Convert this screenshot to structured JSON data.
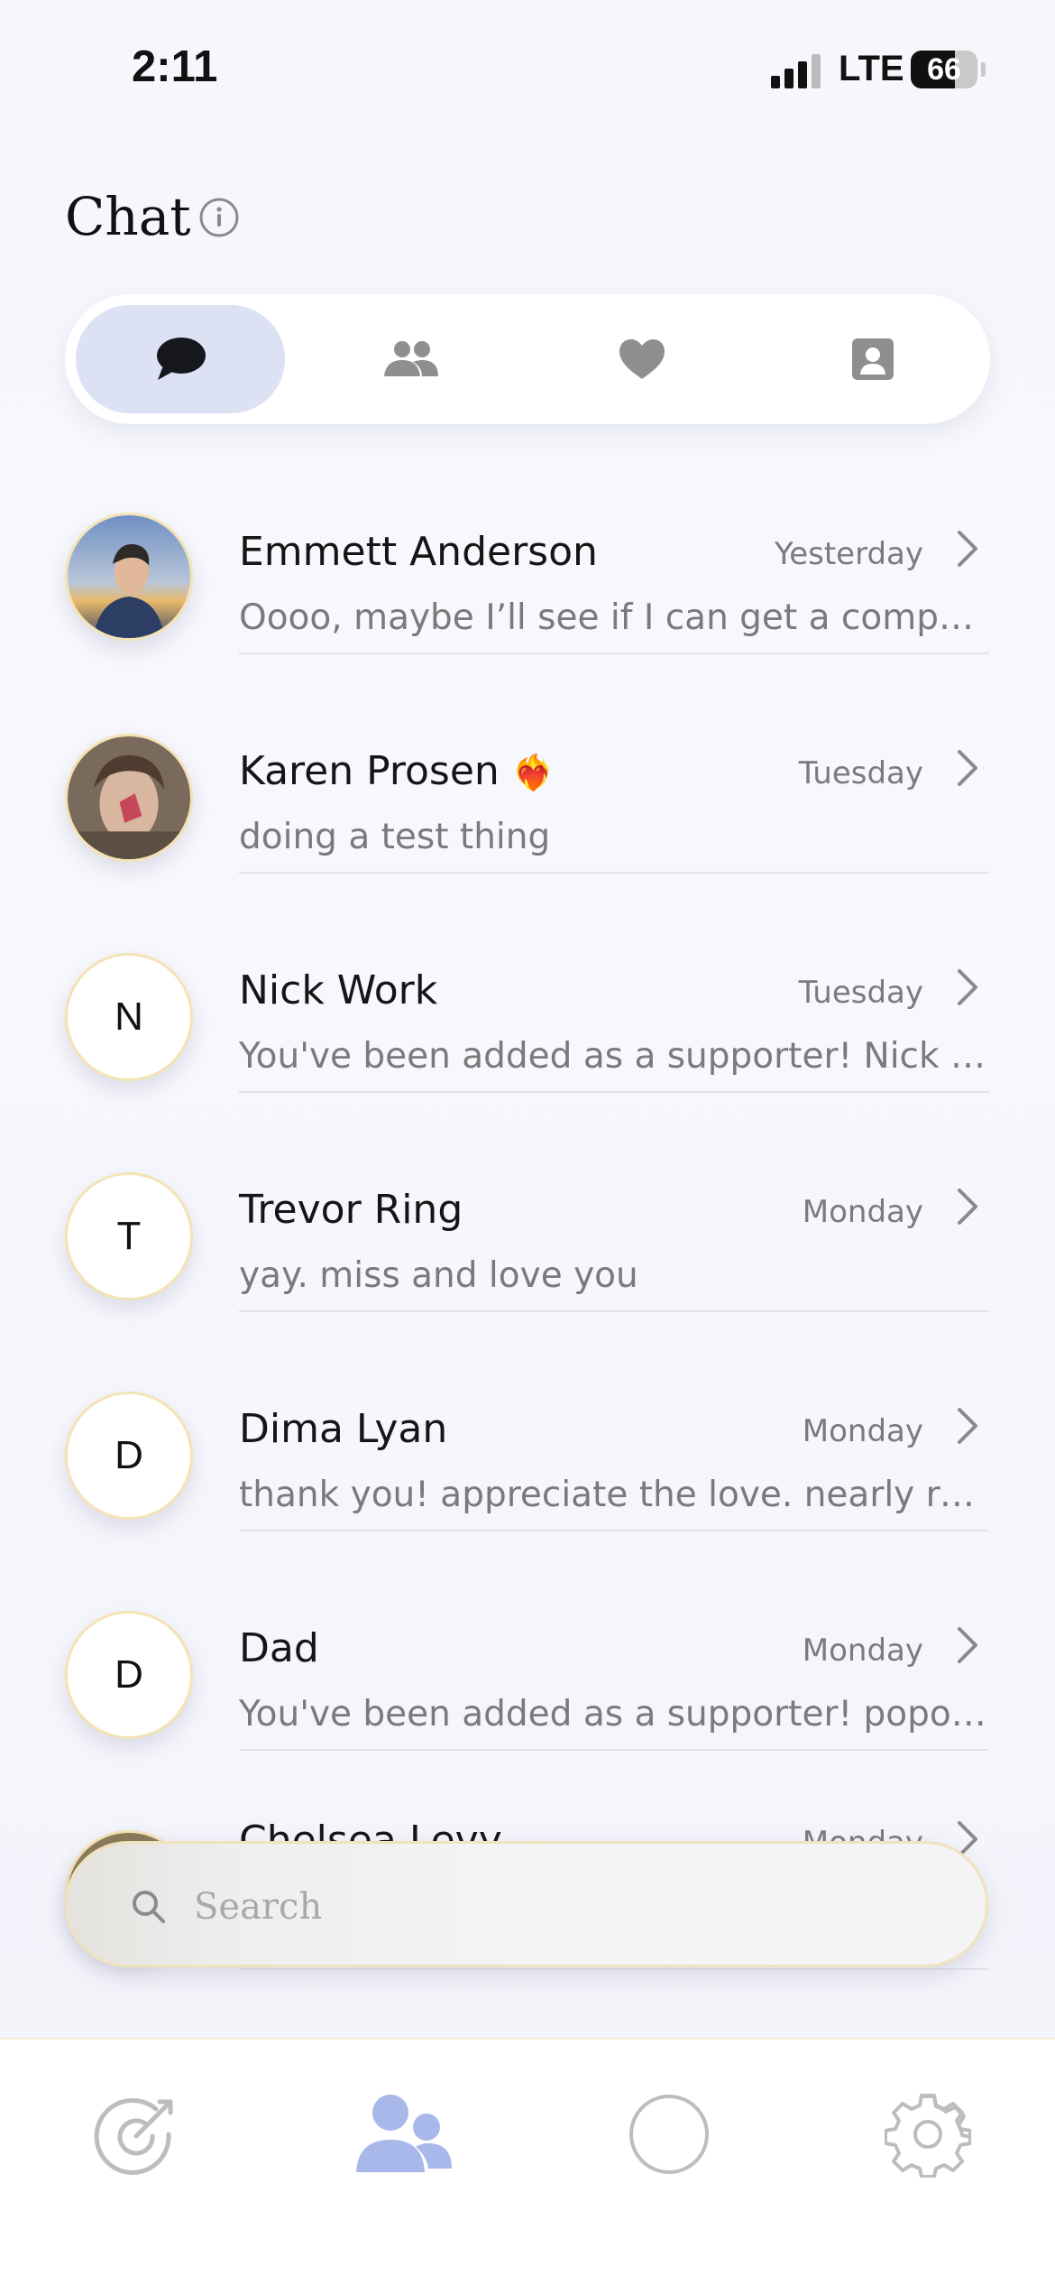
{
  "status_bar": {
    "time": "2:11",
    "network": "LTE",
    "battery": "66",
    "battery_level": 0.66
  },
  "header": {
    "title": "Chat",
    "info_icon": "info-circle-icon"
  },
  "tabs": [
    {
      "icon": "chat-bubble-icon",
      "active": true
    },
    {
      "icon": "people-icon",
      "active": false
    },
    {
      "icon": "heart-icon",
      "active": false
    },
    {
      "icon": "contact-card-icon",
      "active": false
    }
  ],
  "chats": [
    {
      "name": "Emmett Anderson",
      "time": "Yesterday",
      "preview": "Oooo, maybe I’ll see if I can get a companion",
      "avatar": "photo"
    },
    {
      "name": "Karen Prosen",
      "emoji": "❤️‍🔥",
      "time": "Tuesday",
      "preview": "doing a test thing",
      "avatar": "photo"
    },
    {
      "name": "Nick Work",
      "time": "Tuesday",
      "preview": "You've been added as a supporter! Nick would like",
      "avatar": "N"
    },
    {
      "name": "Trevor Ring",
      "time": "Monday",
      "preview": "yay. miss and love you",
      "avatar": "T"
    },
    {
      "name": "Dima Lyan",
      "time": "Monday",
      "preview": "thank you! appreciate the love. nearly ready",
      "avatar": "D"
    },
    {
      "name": "Dad",
      "time": "Monday",
      "preview": "You've been added as a supporter! popo would",
      "avatar": "D"
    },
    {
      "name": "Chelsea Levy",
      "time": "Monday",
      "preview": "",
      "avatar": "photo"
    }
  ],
  "search": {
    "placeholder": "Search"
  },
  "bottom_nav": [
    {
      "icon": "target-arrow-icon",
      "active": false
    },
    {
      "icon": "people-icon",
      "active": true
    },
    {
      "icon": "circle-icon",
      "active": false
    },
    {
      "icon": "gear-icon",
      "active": false
    }
  ],
  "colors": {
    "accent": "#a9b8ea",
    "tab_active_bg": "#dde1f4",
    "avatar_border": "#f4e3b4"
  }
}
